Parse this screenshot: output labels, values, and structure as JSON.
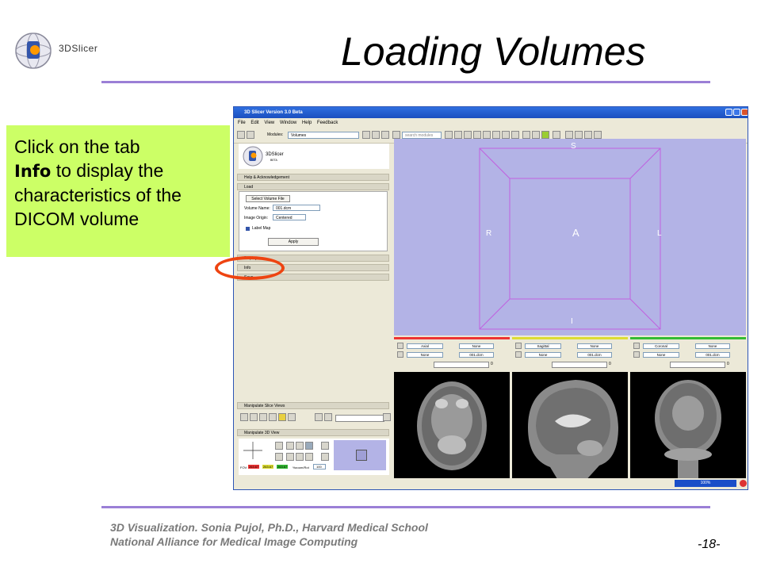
{
  "slide": {
    "title": "Loading Volumes",
    "logo_text": "3DSlicer",
    "footer_line1": "3D Visualization. Sonia Pujol, Ph.D., Harvard Medical School",
    "footer_line2": "National Alliance for Medical Image Computing",
    "page_number": "-18-",
    "accent_color": "#9b7fd6"
  },
  "callout": {
    "text_before": "Click on the tab",
    "keyword": "Info",
    "text_after": "to display the characteristics of the DICOM volume",
    "background": "#ccff66"
  },
  "window": {
    "title": "3D Slicer Version 3.0 Beta",
    "menu": [
      "File",
      "Edit",
      "View",
      "Window",
      "Help",
      "Feedback"
    ],
    "modules_label": "Modules:",
    "modules_value": "Volumes",
    "search_placeholder": "search modules",
    "logo_text": "3DSlicer",
    "logo_sub": "BETA"
  },
  "left_panel": {
    "sections": {
      "help": "Help & Acknowledgement",
      "load": "Load",
      "display": "Display",
      "info": "Info",
      "save": "Save",
      "manipulate_slice": "Manipulate Slice Views",
      "manipulate_3d": "Manipulate 3D View"
    },
    "load": {
      "select_button": "Select Volume File",
      "volume_name_label": "Volume Name:",
      "volume_name_value": "001.dcm",
      "image_origin_label": "Image Origin:",
      "image_origin_value": "Centered",
      "label_map": "Label Map",
      "apply": "Apply"
    },
    "fov_label": "FOV:",
    "fov_values": [
      "263.67",
      "263.67",
      "263.67"
    ],
    "fov_value_colors": [
      "#ee3333",
      "#dddd33",
      "#33bb33"
    ],
    "zoom_label": "%zoom/Rot",
    "zoom_value": "100"
  },
  "view3d": {
    "background": "#b3b3e6",
    "labels": {
      "S": "S",
      "I": "I",
      "R": "R",
      "L": "L",
      "A": "A"
    }
  },
  "slice_views": [
    {
      "orientation": "Axial",
      "fg": "None",
      "bg": "None",
      "vol": "001.dcm",
      "value": "0",
      "color": "#ee3333"
    },
    {
      "orientation": "Sagittal",
      "fg": "None",
      "bg": "None",
      "vol": "001.dcm",
      "value": "0",
      "color": "#dddd33"
    },
    {
      "orientation": "Coronal",
      "fg": "None",
      "bg": "None",
      "vol": "001.dcm",
      "value": "0",
      "color": "#33bb33"
    }
  ],
  "status": {
    "progress": "100%"
  }
}
